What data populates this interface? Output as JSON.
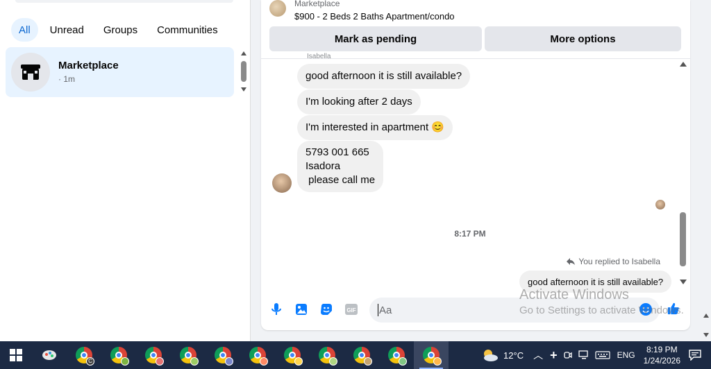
{
  "filters": [
    "All",
    "Unread",
    "Groups",
    "Communities"
  ],
  "conversation": {
    "name": "Marketplace",
    "time": "· 1m"
  },
  "listing": {
    "source": "Marketplace",
    "title": "$900 - 2 Beds 2 Baths Apartment/condo"
  },
  "actions": {
    "pending": "Mark as pending",
    "more": "More options"
  },
  "sender_snippet": "Isabella",
  "messages": [
    "good afternoon it is still available?",
    "I'm looking after 2 days",
    "I'm interested in apartment 😊",
    "5793 001 665",
    "Isadora",
    " please call me"
  ],
  "timestamp": "8:17 PM",
  "replied_label": "You replied to Isabella",
  "reply_quote": "good afternoon it is still available?",
  "composer": {
    "placeholder": "Aa"
  },
  "watermark": {
    "line1": "Activate Windows",
    "line2": "Go to Settings to activate Windows."
  },
  "taskbar": {
    "weather": "12°C",
    "lang": "ENG",
    "time": "8:19 PM",
    "date": "1/24/2026",
    "badge_letter": "C"
  },
  "colors": {
    "accent": "#0a7cff",
    "like": "#0a7cff",
    "taskbar": "#1c2a44"
  }
}
